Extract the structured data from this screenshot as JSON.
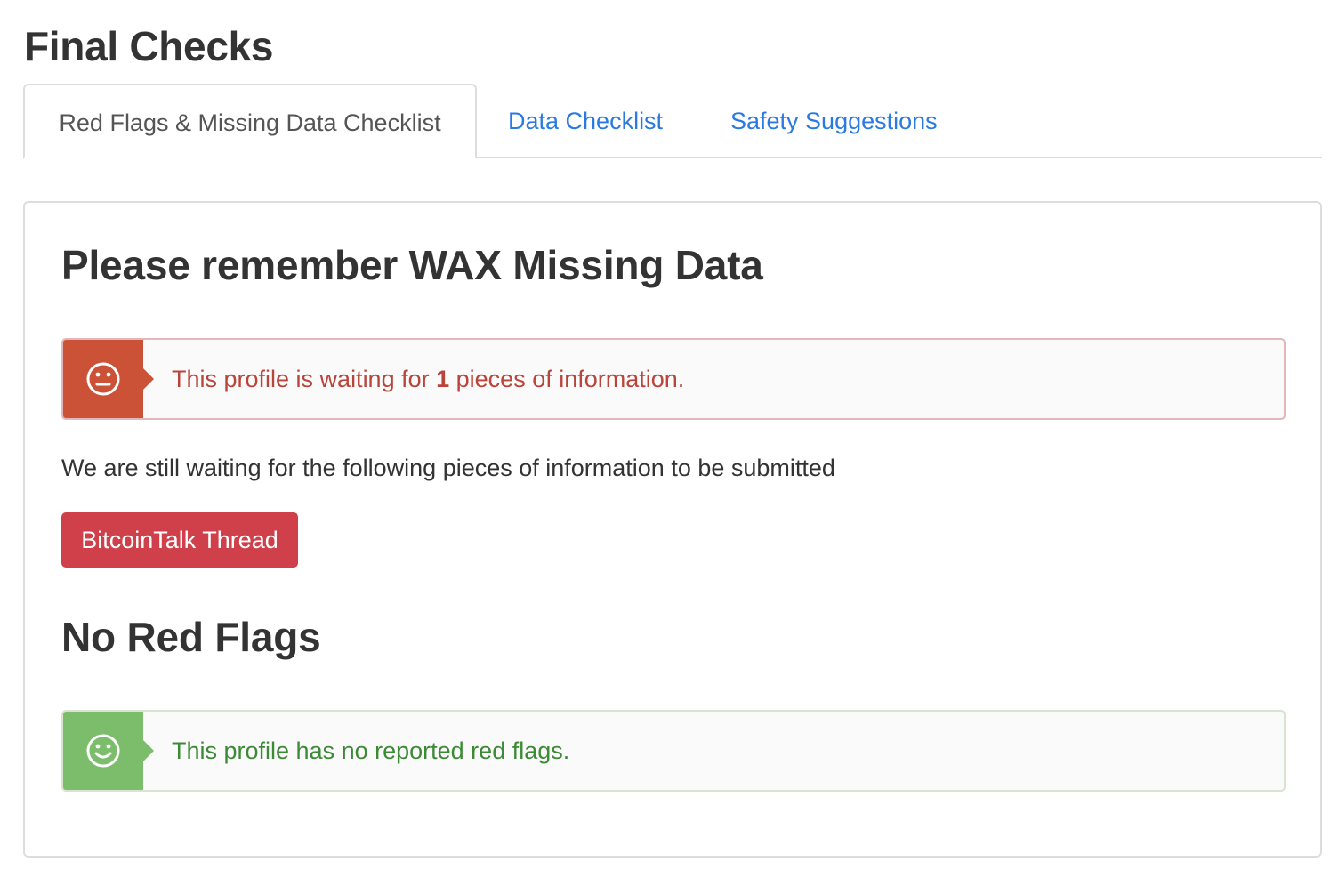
{
  "page": {
    "title": "Final Checks"
  },
  "tabs": [
    {
      "label": "Red Flags & Missing Data Checklist",
      "active": true
    },
    {
      "label": "Data Checklist",
      "active": false
    },
    {
      "label": "Safety Suggestions",
      "active": false
    }
  ],
  "missing_section": {
    "heading": "Please remember WAX Missing Data",
    "alert": {
      "icon": "neutral-face-icon",
      "text_before": "This profile is waiting for ",
      "count": "1",
      "text_after": " pieces of information."
    },
    "waiting_text": "We are still waiting for the following pieces of information to be submitted",
    "missing_items": [
      {
        "label": "BitcoinTalk Thread"
      }
    ]
  },
  "red_flags_section": {
    "heading": "No Red Flags",
    "alert": {
      "icon": "smile-face-icon",
      "text": "This profile has no reported red flags."
    }
  },
  "colors": {
    "danger": "#cc5237",
    "danger_text": "#b9443a",
    "success": "#7cbd6b",
    "success_text": "#3c8a35",
    "link": "#2a7ae2",
    "button_danger": "#d0404a"
  }
}
